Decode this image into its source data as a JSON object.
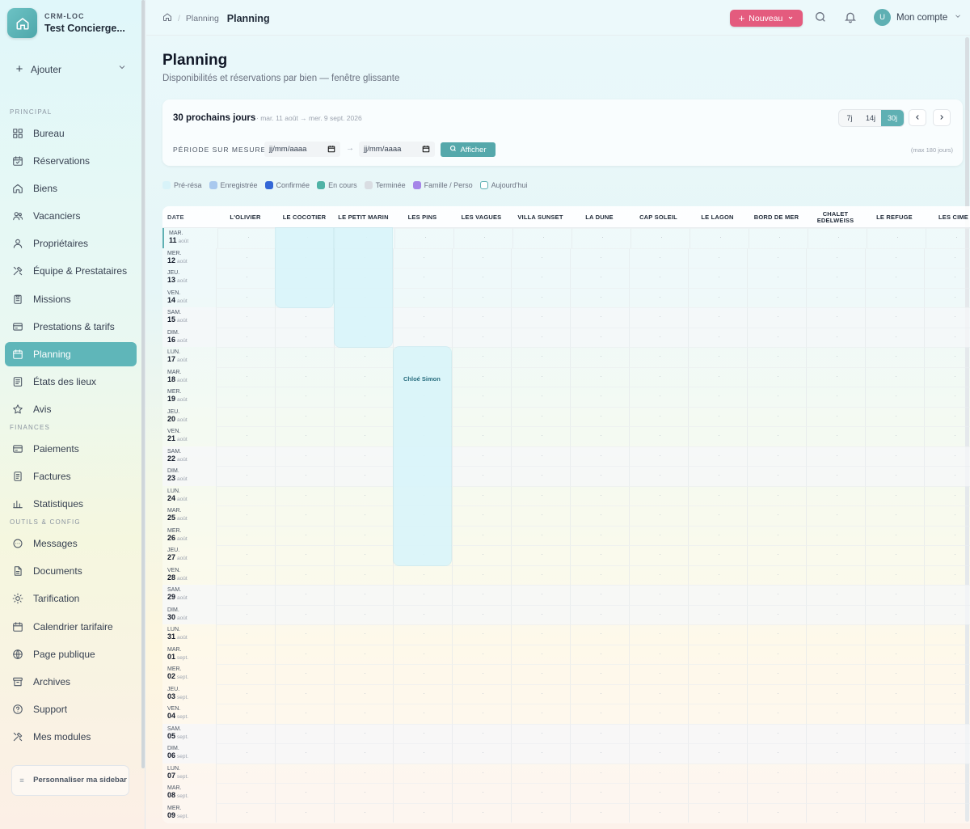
{
  "sidebar": {
    "brand_sub": "CRM-LOC",
    "brand_name": "Test Concierge...",
    "add_label": "Ajouter",
    "sections": {
      "principal": "PRINCIPAL",
      "finances": "FINANCES",
      "outils": "OUTILS & CONFIG"
    },
    "items": [
      {
        "label": "Bureau",
        "icon": "grid-icon"
      },
      {
        "label": "Réservations",
        "icon": "calendar-check-icon"
      },
      {
        "label": "Biens",
        "icon": "home-icon"
      },
      {
        "label": "Vacanciers",
        "icon": "users-icon"
      },
      {
        "label": "Propriétaires",
        "icon": "user-icon"
      },
      {
        "label": "Équipe & Prestataires",
        "icon": "tools-icon"
      },
      {
        "label": "Missions",
        "icon": "clipboard-icon"
      },
      {
        "label": "Prestations & tarifs",
        "icon": "tag-icon"
      },
      {
        "label": "Planning",
        "icon": "calendar-icon"
      },
      {
        "label": "États des lieux",
        "icon": "checklist-icon"
      },
      {
        "label": "Avis",
        "icon": "star-icon"
      },
      {
        "label": "Paiements",
        "icon": "credit-card-icon"
      },
      {
        "label": "Factures",
        "icon": "invoice-icon"
      },
      {
        "label": "Statistiques",
        "icon": "bar-chart-icon"
      },
      {
        "label": "Messages",
        "icon": "message-icon"
      },
      {
        "label": "Documents",
        "icon": "document-icon"
      },
      {
        "label": "Tarification",
        "icon": "sun-icon"
      },
      {
        "label": "Calendrier tarifaire",
        "icon": "calendar-icon"
      },
      {
        "label": "Page publique",
        "icon": "globe-icon"
      },
      {
        "label": "Archives",
        "icon": "archive-icon"
      },
      {
        "label": "Support",
        "icon": "help-icon"
      },
      {
        "label": "Mes modules",
        "icon": "tools-icon"
      }
    ],
    "customize_label": "Personnaliser ma sidebar"
  },
  "topbar": {
    "breadcrumb_parent": "Planning",
    "breadcrumb_current": "Planning",
    "new_label": "Nouveau",
    "account_initial": "U",
    "account_label": "Mon compte"
  },
  "page": {
    "title": "Planning",
    "subtitle": "Disponibilités et réservations par bien — fenêtre glissante"
  },
  "controls": {
    "window_title": "30 prochains jours",
    "window_range": "· mar. 11 août → mer. 9 sept. 2026",
    "ranges": [
      "7j",
      "14j",
      "30j"
    ],
    "active_range": "30j",
    "period_label": "PÉRIODE SUR MESURE :",
    "date_placeholder": "jj/mm/aaaa",
    "show_label": "Afficher",
    "max_note": "(max 180 jours)"
  },
  "legend": [
    {
      "label": "Pré-résa",
      "color": "#d8f3f9"
    },
    {
      "label": "Enregistrée",
      "color": "#a9c9ee"
    },
    {
      "label": "Confirmée",
      "color": "#3367d6"
    },
    {
      "label": "En cours",
      "color": "#4fb3a6"
    },
    {
      "label": "Terminée",
      "color": "#d9dde2"
    },
    {
      "label": "Famille / Perso",
      "color": "#a585e8"
    },
    {
      "label": "Aujourd'hui",
      "color": "#5fb0b3"
    }
  ],
  "planning": {
    "date_header": "DATE",
    "properties": [
      "L'OLIVIER",
      "LE COCOTIER",
      "LE PETIT MARIN",
      "LES PINS",
      "LES VAGUES",
      "VILLA SUNSET",
      "LA DUNE",
      "CAP SOLEIL",
      "LE LAGON",
      "BORD DE MER",
      "CHALET EDELWEISS",
      "LE REFUGE",
      "LES CIME"
    ],
    "days": [
      {
        "dow": "MAR.",
        "day": "11",
        "month": "août",
        "weekend": false,
        "today": true
      },
      {
        "dow": "MER.",
        "day": "12",
        "month": "août",
        "weekend": false
      },
      {
        "dow": "JEU.",
        "day": "13",
        "month": "août",
        "weekend": false
      },
      {
        "dow": "VEN.",
        "day": "14",
        "month": "août",
        "weekend": false
      },
      {
        "dow": "SAM.",
        "day": "15",
        "month": "août",
        "weekend": true
      },
      {
        "dow": "DIM.",
        "day": "16",
        "month": "août",
        "weekend": true
      },
      {
        "dow": "LUN.",
        "day": "17",
        "month": "août",
        "weekend": false
      },
      {
        "dow": "MAR.",
        "day": "18",
        "month": "août",
        "weekend": false
      },
      {
        "dow": "MER.",
        "day": "19",
        "month": "août",
        "weekend": false
      },
      {
        "dow": "JEU.",
        "day": "20",
        "month": "août",
        "weekend": false
      },
      {
        "dow": "VEN.",
        "day": "21",
        "month": "août",
        "weekend": false
      },
      {
        "dow": "SAM.",
        "day": "22",
        "month": "août",
        "weekend": true
      },
      {
        "dow": "DIM.",
        "day": "23",
        "month": "août",
        "weekend": true
      },
      {
        "dow": "LUN.",
        "day": "24",
        "month": "août",
        "weekend": false
      },
      {
        "dow": "MAR.",
        "day": "25",
        "month": "août",
        "weekend": false
      },
      {
        "dow": "MER.",
        "day": "26",
        "month": "août",
        "weekend": false
      },
      {
        "dow": "JEU.",
        "day": "27",
        "month": "août",
        "weekend": false
      },
      {
        "dow": "VEN.",
        "day": "28",
        "month": "août",
        "weekend": false
      },
      {
        "dow": "SAM.",
        "day": "29",
        "month": "août",
        "weekend": true
      },
      {
        "dow": "DIM.",
        "day": "30",
        "month": "août",
        "weekend": true
      },
      {
        "dow": "LUN.",
        "day": "31",
        "month": "août",
        "weekend": false
      },
      {
        "dow": "MAR.",
        "day": "01",
        "month": "sept.",
        "weekend": false
      },
      {
        "dow": "MER.",
        "day": "02",
        "month": "sept.",
        "weekend": false
      },
      {
        "dow": "JEU.",
        "day": "03",
        "month": "sept.",
        "weekend": false
      },
      {
        "dow": "VEN.",
        "day": "04",
        "month": "sept.",
        "weekend": false
      },
      {
        "dow": "SAM.",
        "day": "05",
        "month": "sept.",
        "weekend": true
      },
      {
        "dow": "DIM.",
        "day": "06",
        "month": "sept.",
        "weekend": true
      },
      {
        "dow": "LUN.",
        "day": "07",
        "month": "sept.",
        "weekend": false
      },
      {
        "dow": "MAR.",
        "day": "08",
        "month": "sept.",
        "weekend": false
      },
      {
        "dow": "MER.",
        "day": "09",
        "month": "sept.",
        "weekend": false
      }
    ],
    "reservations": [
      {
        "property": "LE COCOTIER",
        "start": "11",
        "end": "14",
        "guest": ""
      },
      {
        "property": "LE PETIT MARIN",
        "start": "11",
        "end": "16",
        "guest": ""
      },
      {
        "property": "LES PINS",
        "start": "17",
        "end": "27",
        "guest": "Chloé Simon"
      }
    ]
  }
}
